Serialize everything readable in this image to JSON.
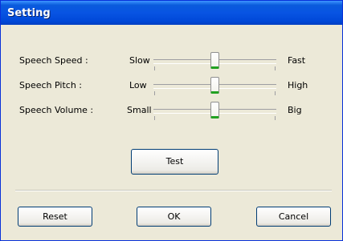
{
  "window": {
    "title": "Setting"
  },
  "sliders": [
    {
      "label": "Speech Speed :",
      "min_label": "Slow",
      "max_label": "Fast",
      "value": 0.5
    },
    {
      "label": "Speech Pitch :",
      "min_label": "Low",
      "max_label": "High",
      "value": 0.5
    },
    {
      "label": "Speech Volume :",
      "min_label": "Small",
      "max_label": "Big",
      "value": 0.5
    }
  ],
  "buttons": {
    "test": "Test",
    "reset": "Reset",
    "ok": "OK",
    "cancel": "Cancel"
  }
}
